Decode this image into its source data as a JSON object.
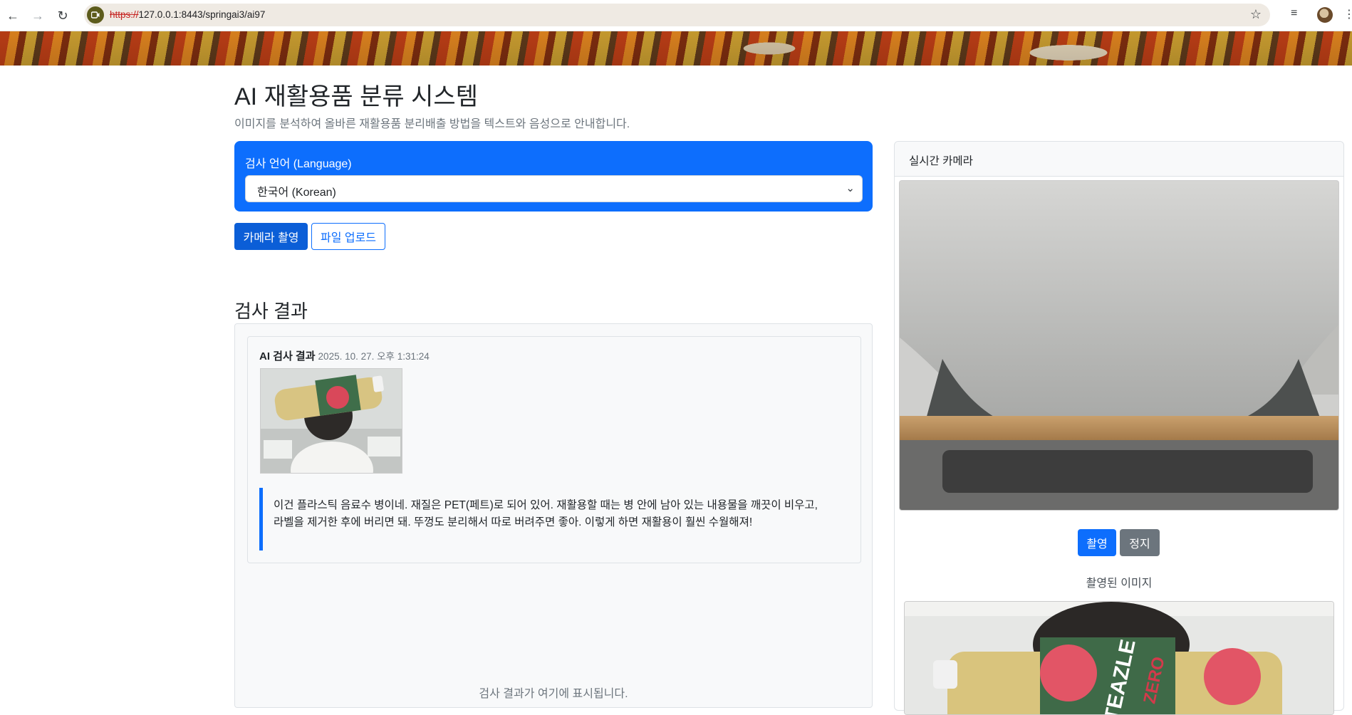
{
  "browser": {
    "url_protocol": "https://",
    "url_rest": "127.0.0.1:8443/springai3/ai97",
    "back_icon": "arrow-left-icon",
    "forward_icon": "arrow-right-icon",
    "reload_icon": "reload-icon",
    "bookmark_icon": "star-icon"
  },
  "header": {
    "title": "AI 재활용품 분류 시스템",
    "subtitle": "이미지를 분석하여 올바른 재활용품 분리배출 방법을 텍스트와 음성으로 안내합니다."
  },
  "language": {
    "label": "검사 언어 (Language)",
    "selected": "한국어 (Korean)"
  },
  "actions": {
    "camera_label": "카메라 촬영",
    "upload_label": "파일 업로드"
  },
  "results": {
    "title": "검사 결과",
    "card": {
      "heading": "AI 검사 결과",
      "timestamp": "2025. 10. 27. 오후 1:31:24",
      "text": "이건 플라스틱 음료수 병이네. 재질은 PET(페트)로 되어 있어. 재활용할 때는 병 안에 남아 있는 내용물을 깨끗이 비우고, 라벨을 제거한 후에 버리면 돼. 뚜껑도 분리해서 따로 버려주면 좋아. 이렇게 하면 재활용이 훨씬 수월해져!"
    },
    "placeholder": "검사 결과가 여기에 표시됩니다."
  },
  "camera": {
    "title": "실시간 카메라",
    "capture_label": "촬영",
    "stop_label": "정지",
    "captured_title": "촬영된 이미지",
    "bottle_label": "TEAZLE",
    "bottle_sublabel": "ZERO"
  },
  "colors": {
    "primary": "#0d6efd",
    "secondary": "#6c757d"
  }
}
